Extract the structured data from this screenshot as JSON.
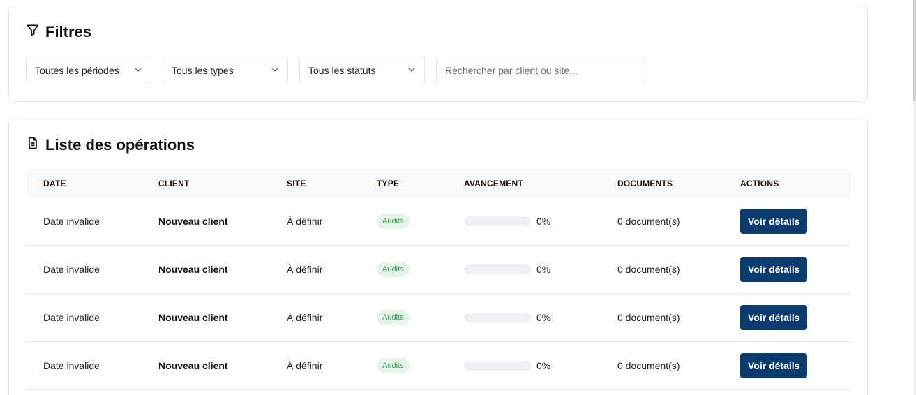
{
  "filters": {
    "title": "Filtres",
    "period_value": "Toutes les périodes",
    "type_value": "Tous les types",
    "status_value": "Tous les statuts",
    "search_placeholder": "Rechercher par client ou site..."
  },
  "operations": {
    "title": "Liste des opérations",
    "columns": [
      "DATE",
      "CLIENT",
      "SITE",
      "TYPE",
      "AVANCEMENT",
      "DOCUMENTS",
      "ACTIONS"
    ],
    "rows": [
      {
        "date": "Date invalide",
        "client": "Nouveau client",
        "site": "À définir",
        "type": "Audits",
        "progress": 0,
        "progress_label": "0%",
        "documents": "0 document(s)",
        "action": "Voir détails"
      },
      {
        "date": "Date invalide",
        "client": "Nouveau client",
        "site": "À définir",
        "type": "Audits",
        "progress": 0,
        "progress_label": "0%",
        "documents": "0 document(s)",
        "action": "Voir détails"
      },
      {
        "date": "Date invalide",
        "client": "Nouveau client",
        "site": "À définir",
        "type": "Audits",
        "progress": 0,
        "progress_label": "0%",
        "documents": "0 document(s)",
        "action": "Voir détails"
      },
      {
        "date": "Date invalide",
        "client": "Nouveau client",
        "site": "À définir",
        "type": "Audits",
        "progress": 0,
        "progress_label": "0%",
        "documents": "0 document(s)",
        "action": "Voir détails"
      }
    ]
  },
  "icons": {
    "filter": "filter-icon",
    "document": "document-icon",
    "chevron": "chevron-down-icon"
  },
  "colors": {
    "primary": "#0b3b6f",
    "badge_bg": "#e6f4ea",
    "badge_text": "#3a9a4f",
    "header_bg": "#f8f9fa"
  }
}
